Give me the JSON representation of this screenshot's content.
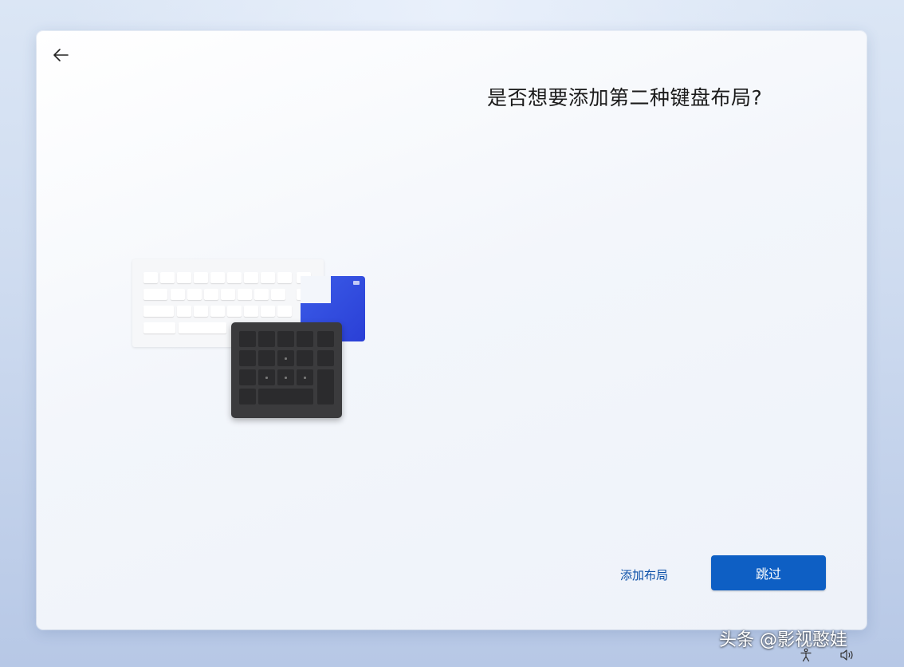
{
  "page": {
    "title": "是否想要添加第二种键盘布局?"
  },
  "navigation": {
    "back_icon": "arrow-left-icon"
  },
  "actions": {
    "add_layout_label": "添加布局",
    "skip_label": "跳过"
  },
  "watermark": {
    "text": "头条 @影视憨娃"
  },
  "system_tray": {
    "icons": [
      "accessibility-icon",
      "volume-icon"
    ]
  },
  "colors": {
    "accent": "#0e5fc4",
    "link": "#0a4fa8",
    "title_text": "#1b1b1b"
  }
}
